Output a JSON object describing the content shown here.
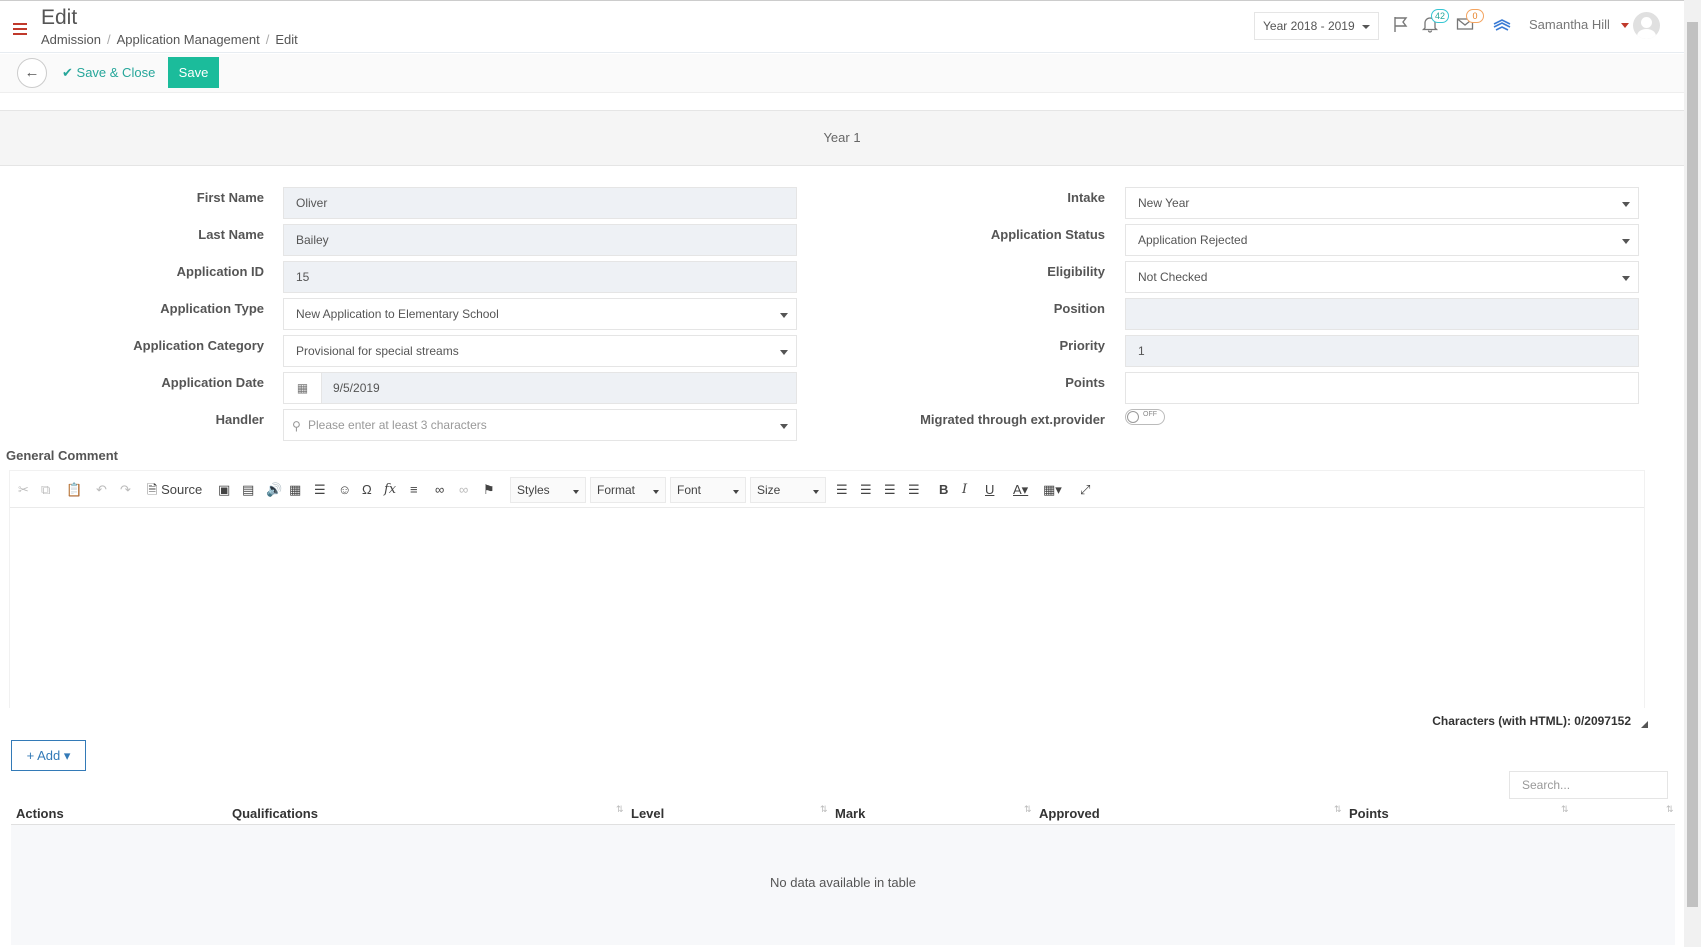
{
  "header": {
    "title": "Edit",
    "breadcrumb": [
      "Admission",
      "Application Management",
      "Edit"
    ],
    "year_select": "Year 2018 - 2019",
    "notification_count": "42",
    "message_count": "0",
    "user_name": "Samantha Hill",
    "icons": [
      "menu-icon",
      "flag-icon",
      "bell-icon",
      "envelope-icon",
      "layers-icon",
      "avatar"
    ]
  },
  "actions": {
    "save_close_label": "Save & Close",
    "save_label": "Save"
  },
  "section": {
    "title": "Year 1"
  },
  "form_left": {
    "first_name": {
      "label": "First Name",
      "value": "Oliver"
    },
    "last_name": {
      "label": "Last Name",
      "value": "Bailey"
    },
    "application_id": {
      "label": "Application ID",
      "value": "15"
    },
    "application_type": {
      "label": "Application Type",
      "value": "New Application to Elementary School"
    },
    "application_category": {
      "label": "Application Category",
      "value": "Provisional for special streams"
    },
    "application_date": {
      "label": "Application Date",
      "value": "9/5/2019"
    },
    "handler": {
      "label": "Handler",
      "placeholder": "Please enter at least 3 characters"
    }
  },
  "form_right": {
    "intake": {
      "label": "Intake",
      "value": "New Year"
    },
    "application_status": {
      "label": "Application Status",
      "value": "Application Rejected"
    },
    "eligibility": {
      "label": "Eligibility",
      "value": "Not Checked"
    },
    "position": {
      "label": "Position",
      "value": ""
    },
    "priority": {
      "label": "Priority",
      "value": "1"
    },
    "points": {
      "label": "Points",
      "value": ""
    },
    "migrated": {
      "label": "Migrated through ext.provider",
      "toggle_text": "OFF",
      "state": "off"
    }
  },
  "editor": {
    "label": "General Comment",
    "source_label": "Source",
    "styles_label": "Styles",
    "format_label": "Format",
    "font_label": "Font",
    "size_label": "Size",
    "char_count": "Characters (with HTML): 0/2097152"
  },
  "table": {
    "add_label": "Add",
    "search_placeholder": "Search...",
    "columns": [
      "Actions",
      "Qualifications",
      "Level",
      "Mark",
      "Approved",
      "Points"
    ],
    "empty_text": "No data available in table"
  },
  "colors": {
    "accent_green": "#1bbc9b",
    "link_blue": "#337ab7",
    "menu_red": "#c0392b"
  }
}
